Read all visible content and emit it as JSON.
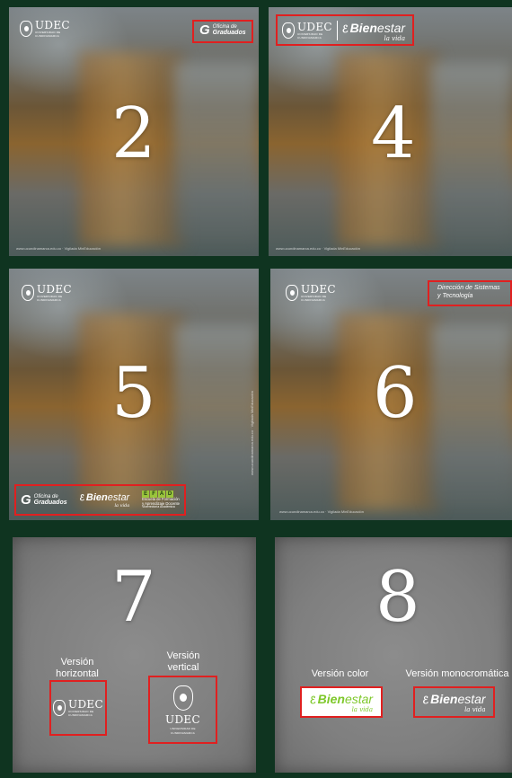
{
  "numbers": {
    "p2": "2",
    "p4": "4",
    "p5": "5",
    "p6": "6",
    "p7": "7",
    "p8": "8"
  },
  "udec": {
    "title": "UDEC",
    "sub1": "UNIVERSIDAD DE",
    "sub2": "CUNDINAMARCA"
  },
  "graduados": {
    "g": "G",
    "line1": "Oficina de",
    "line2": "Graduados"
  },
  "bienestar": {
    "icon": "ℰ",
    "word_bold": "Bien",
    "word_rest": "estar",
    "tagline": "la vida"
  },
  "direccion": {
    "line1": "Dirección de Sistemas",
    "line2": "y Tecnología"
  },
  "efad": {
    "blocks": [
      "E",
      "F",
      "A",
      "D"
    ],
    "line1": "Escuela de Formación",
    "line2": "y Aprendizaje Docente",
    "line3": "Vicerrectoría Académica"
  },
  "footer": {
    "url": "www.ucundinamarca.edu.co",
    "hashtag": "Vigilada MinEducación"
  },
  "panel7": {
    "horizontal_label_1": "Versión",
    "horizontal_label_2": "horizontal",
    "vertical_label_1": "Versión",
    "vertical_label_2": "vertical"
  },
  "panel8": {
    "color_label": "Versión color",
    "mono_label": "Versión monocromática"
  },
  "colors": {
    "background": "#0f3420",
    "highlight": "#e02020",
    "bienestar_green": "#7ec82a"
  }
}
